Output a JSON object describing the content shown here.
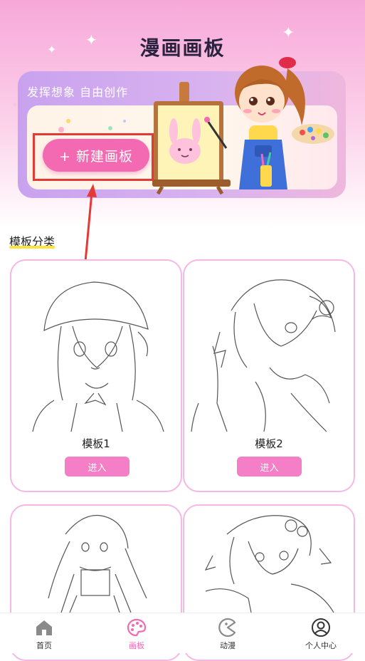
{
  "header": {
    "title": "漫画画板"
  },
  "banner": {
    "tagline": "发挥想象 自由创作",
    "new_board_label": "+ 新建画板"
  },
  "section": {
    "title": "模板分类"
  },
  "templates": [
    {
      "title": "模板1",
      "enter_label": "进入"
    },
    {
      "title": "模板2",
      "enter_label": "进入"
    },
    {
      "title": "",
      "enter_label": ""
    },
    {
      "title": "",
      "enter_label": ""
    }
  ],
  "tabbar": {
    "items": [
      {
        "label": "首页",
        "icon": "home-icon"
      },
      {
        "label": "画板",
        "icon": "palette-icon",
        "active": true
      },
      {
        "label": "动漫",
        "icon": "pacman-icon"
      },
      {
        "label": "个人中心",
        "icon": "user-icon"
      }
    ]
  },
  "colors": {
    "accent": "#f36ab2",
    "active_tab": "#f36ab2",
    "card_border": "#f5b8e4",
    "underline": "#ffe23d",
    "annotation": "#e53935"
  }
}
